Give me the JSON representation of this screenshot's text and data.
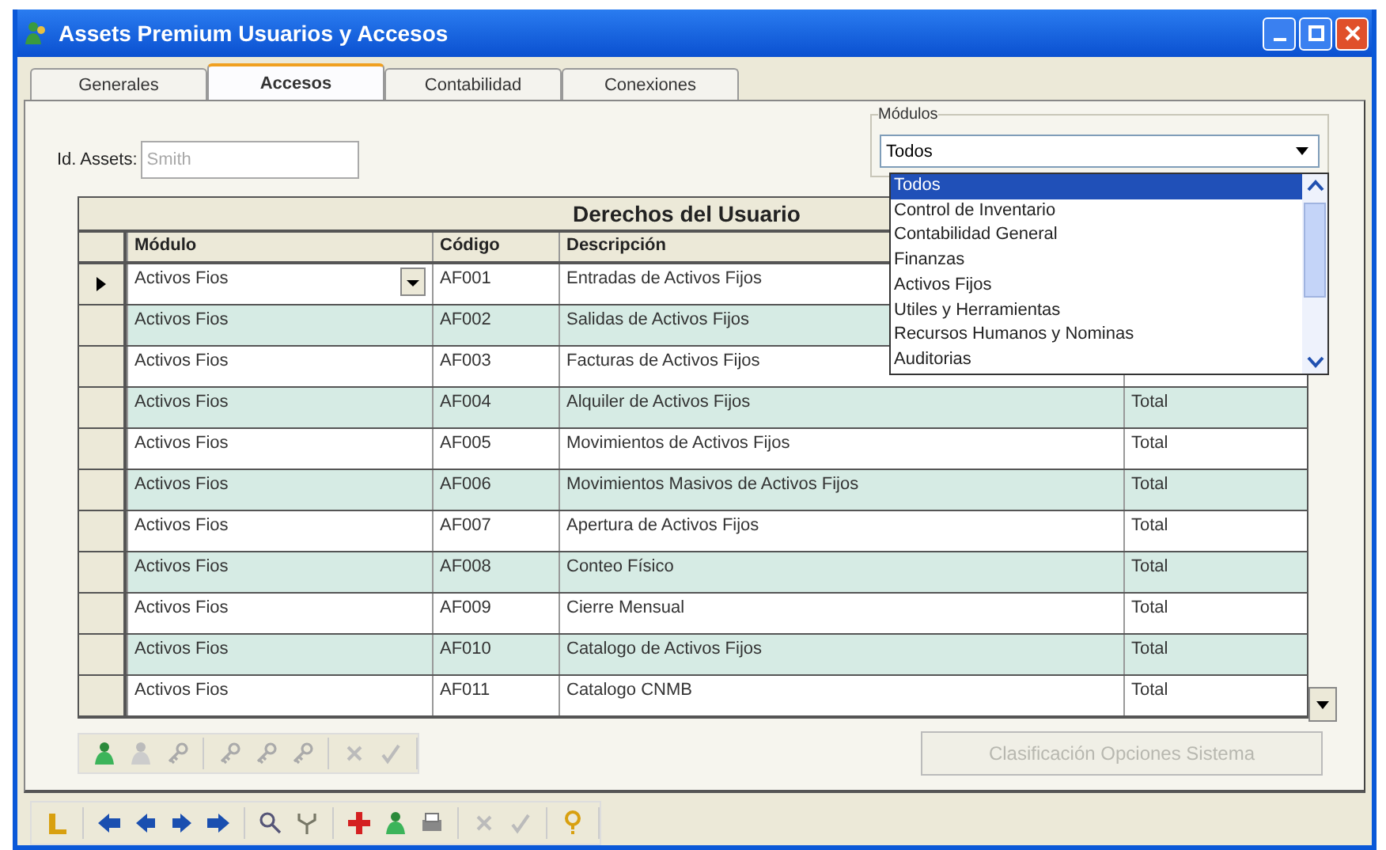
{
  "window": {
    "title": "Assets Premium  Usuarios y Accesos"
  },
  "tabs": [
    {
      "label": "Generales",
      "selected": false
    },
    {
      "label": "Accesos",
      "selected": true
    },
    {
      "label": "Contabilidad",
      "selected": false
    },
    {
      "label": "Conexiones",
      "selected": false
    }
  ],
  "id_field": {
    "label": "Id. Assets:",
    "value": "Smith",
    "disabled": true
  },
  "modules": {
    "label": "Módulos",
    "value": "Todos",
    "options": [
      {
        "label": "Todos",
        "selected": true
      },
      {
        "label": "Control de Inventario",
        "selected": false
      },
      {
        "label": "Contabilidad General",
        "selected": false
      },
      {
        "label": "Finanzas",
        "selected": false
      },
      {
        "label": "Activos Fijos",
        "selected": false
      },
      {
        "label": "Utiles y Herramientas",
        "selected": false
      },
      {
        "label": "Recursos Humanos y Nominas",
        "selected": false
      },
      {
        "label": "Auditorias",
        "selected": false
      }
    ]
  },
  "grid": {
    "title": "Derechos del Usuario",
    "columns": [
      "Módulo",
      "Código",
      "Descripción"
    ],
    "rows": [
      {
        "selected": true,
        "module": "Activos Fios",
        "code": "AF001",
        "description": "Entradas de Activos Fijos"
      },
      {
        "selected": false,
        "module": "Activos Fios",
        "code": "AF002",
        "description": "Salidas de Activos Fijos"
      },
      {
        "selected": false,
        "module": "Activos Fios",
        "code": "AF003",
        "description": "Facturas de Activos Fijos"
      },
      {
        "selected": false,
        "module": "Activos Fios",
        "code": "AF004",
        "description": "Alquiler de Activos Fijos",
        "column_5": "Total"
      },
      {
        "selected": false,
        "module": "Activos Fios",
        "code": "AF005",
        "description": "Movimientos de Activos Fijos",
        "column_5": "Total"
      },
      {
        "selected": false,
        "module": "Activos Fios",
        "code": "AF006",
        "description": "Movimientos Masivos de Activos Fijos",
        "column_5": "Total"
      },
      {
        "selected": false,
        "module": "Activos Fios",
        "code": "AF007",
        "description": "Apertura de Activos Fijos",
        "column_5": "Total"
      },
      {
        "selected": false,
        "module": "Activos Fios",
        "code": "AF008",
        "description": "Conteo Físico",
        "column_5": "Total"
      },
      {
        "selected": false,
        "module": "Activos Fios",
        "code": "AF009",
        "description": "Cierre Mensual",
        "column_5": "Total"
      },
      {
        "selected": false,
        "module": "Activos Fios",
        "code": "AF010",
        "description": "Catalogo de Activos Fijos",
        "column_5": "Total"
      },
      {
        "selected": false,
        "module": "Activos Fios",
        "code": "AF011",
        "description": "Catalogo CNMB",
        "column_5": "Total"
      }
    ]
  },
  "grid_toolbar": [
    [
      {
        "kind": "person",
        "disabled": false
      },
      {
        "kind": "person",
        "disabled": true
      },
      {
        "kind": "key",
        "disabled": true
      }
    ],
    [
      {
        "kind": "key",
        "disabled": true
      },
      {
        "kind": "key",
        "disabled": true
      },
      {
        "kind": "key",
        "disabled": true
      }
    ],
    [
      {
        "kind": "cancel",
        "disabled": true
      },
      {
        "kind": "check",
        "disabled": true
      }
    ]
  ],
  "system_button": {
    "label": "Clasificación Opciones Sistema",
    "disabled": true
  },
  "main_toolbar": [
    [
      {
        "kind": "exit",
        "disabled": false
      }
    ],
    [
      {
        "kind": "first",
        "disabled": false
      },
      {
        "kind": "previous",
        "disabled": false
      },
      {
        "kind": "next",
        "disabled": false
      },
      {
        "kind": "last",
        "disabled": false
      }
    ],
    [
      {
        "kind": "search",
        "disabled": false
      },
      {
        "kind": "filter",
        "disabled": false
      }
    ],
    [
      {
        "kind": "add",
        "disabled": false
      },
      {
        "kind": "person",
        "disabled": false
      },
      {
        "kind": "print",
        "disabled": false
      }
    ],
    [
      {
        "kind": "cancel",
        "disabled": true
      },
      {
        "kind": "check",
        "disabled": true
      }
    ],
    [
      {
        "kind": "help",
        "disabled": false
      }
    ]
  ]
}
